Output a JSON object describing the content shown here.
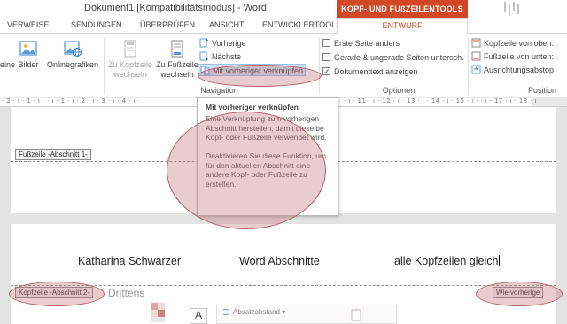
{
  "window": {
    "title": "Dokument1 [Kompatibilitätsmodus] - Word",
    "context_header": "KOPF- UND FUßZEILENTOOLS"
  },
  "tabs": [
    {
      "label": "VERWEISE"
    },
    {
      "label": "SENDUNGEN"
    },
    {
      "label": "ÜBERPRÜFEN"
    },
    {
      "label": "ANSICHT"
    },
    {
      "label": "ENTWICKLERTOOLS"
    },
    {
      "label": "ENTWURF",
      "active": true
    }
  ],
  "ribbon": {
    "insert": {
      "partial_label": "eine",
      "bilder": "Bilder",
      "onlinegrafiken": "Onlinegrafiken"
    },
    "navigation": {
      "zu_kopfzeile_1": "Zu Kopfzeile",
      "zu_kopfzeile_2": "wechseln",
      "zu_fusszeile_1": "Zu Fußzeile",
      "zu_fusszeile_2": "wechseln",
      "vorherige": "Vorherige",
      "naechste": "Nächste",
      "verknuepfen": "Mit vorheriger verknüpfen",
      "group_label": "Navigation"
    },
    "optionen": {
      "erste_seite": "Erste Seite anders",
      "gerade_ungerade": "Gerade & ungerade Seiten untersch.",
      "dokumenttext": "Dokumenttext anzeigen",
      "dokumenttext_checked": true,
      "group_label": "Optionen"
    },
    "position": {
      "kopfzeile_oben": "Kopfzeile von oben:",
      "fusszeile_unten": "Fußzeile von unten:",
      "ausrichtung": "Ausrichtungsabstop",
      "group_label": "Position"
    }
  },
  "ruler": {
    "left_text": "· 2 · ı · 1 · ı ·  · ı · 1 · ı · 2 · ı · 3 · ı · 4 · ı ·",
    "right_text": "· ı · 11 · ı · 12 · ı · 13 · ı · 14 · ı · 15 · ı ·  · ı · 17 · ı · 18 · ı"
  },
  "tooltip": {
    "title": "Mit vorheriger verknüpfen",
    "body": "Eine Verknüpfung zum vorherigen Abschnitt herstellen, damit dieselbe Kopf- oder Fußzeile verwendet wird.\n\nDeaktivieren Sie diese Funktion, um für den aktuellen Abschnitt eine andere Kopf- oder Fußzeile zu erstellen."
  },
  "document": {
    "footer_tag_1": "Fußzeile -Abschnitt 1-",
    "header_tag_2": "Kopfzeile -Abschnitt 2-",
    "same_as_previous": "Wie vorherige",
    "header_left": "Katharina Schwarzer",
    "header_center": "Word Abschnitte",
    "header_right": "alle Kopfzeilen gleich",
    "body_text": "Drittens"
  },
  "mini_toolbar": {
    "absatzabstand": "Absatzabstand ▾"
  },
  "colors": {
    "accent": "#d24726",
    "annotation": "#be6e76",
    "link_button_highlight": "#cfe3f4"
  }
}
